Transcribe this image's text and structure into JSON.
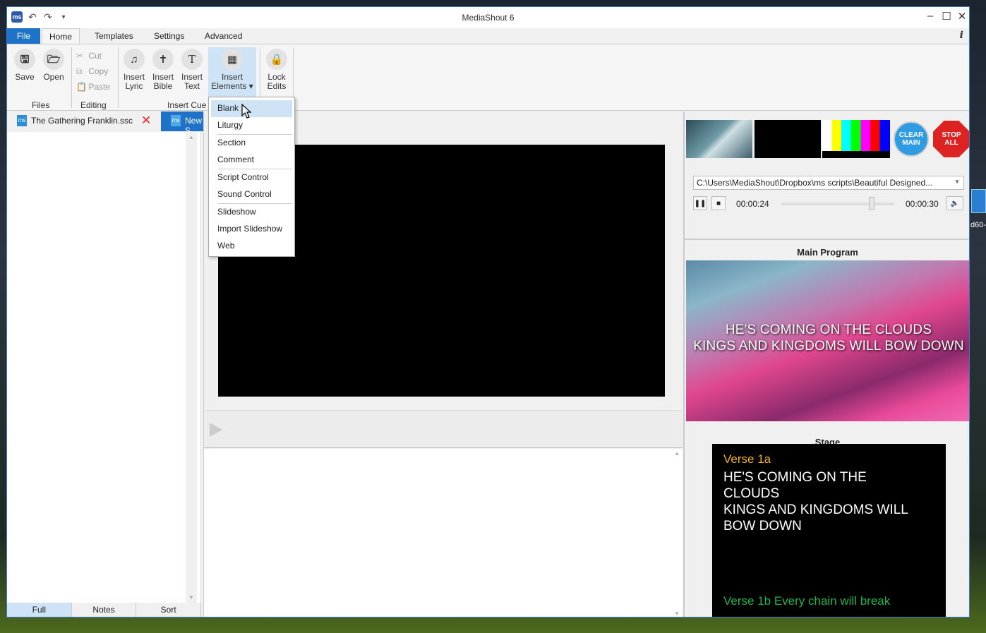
{
  "window": {
    "title": "MediaShout 6"
  },
  "ribbon_tabs": [
    "File",
    "Home",
    "Templates",
    "Settings",
    "Advanced"
  ],
  "ribbon": {
    "save": "Save",
    "open": "Open",
    "cut": "Cut",
    "copy": "Copy",
    "paste": "Paste",
    "insert_lyric": [
      "Insert",
      "Lyric"
    ],
    "insert_bible": [
      "Insert",
      "Bible"
    ],
    "insert_text": [
      "Insert",
      "Text"
    ],
    "insert_elements": [
      "Insert",
      "Elements ▾"
    ],
    "lock_edits": [
      "Lock",
      "Edits"
    ],
    "groups": {
      "files": "Files",
      "editing": "Editing",
      "insert_cue": "Insert Cue"
    }
  },
  "doc_tabs": {
    "tab1": "The Gathering Franklin.ssc",
    "tab2": "New S"
  },
  "bottom_tabs": [
    "Full",
    "Notes",
    "Sort"
  ],
  "menu": {
    "items": [
      "Blank",
      "Liturgy",
      "Section",
      "Comment",
      "Script Control",
      "Sound Control",
      "Slideshow",
      "Import Slideshow",
      "Web"
    ]
  },
  "right": {
    "clear_main": [
      "CLEAR",
      "MAIN"
    ],
    "stop_all": [
      "STOP",
      "ALL"
    ],
    "media_path": "C:\\Users\\MediaShout\\Dropbox\\ms scripts\\Beautiful Designed...",
    "elapsed": "00:00:24",
    "duration": "00:00:30",
    "playback_position": 0.8,
    "main_program_title": "Main Program",
    "main_lyric_1": "HE'S COMING ON THE CLOUDS",
    "main_lyric_2": "KINGS AND KINGDOMS WILL BOW DOWN",
    "stage_title": "Stage",
    "stage_verse": "Verse 1a",
    "stage_lyric_1": "HE'S COMING ON THE",
    "stage_lyric_2": "CLOUDS",
    "stage_lyric_3": "KINGS AND KINGDOMS WILL",
    "stage_lyric_4": "BOW DOWN",
    "stage_next": "Verse 1b Every chain will break"
  },
  "desktop": {
    "label": "d60-"
  },
  "colors": {
    "accent": "#1e73c8",
    "highlight": "#cfe3f7",
    "stop": "#dd2222",
    "clear": "#2e9be3",
    "verse": "#f4b020",
    "next_verse": "#23b34a"
  }
}
